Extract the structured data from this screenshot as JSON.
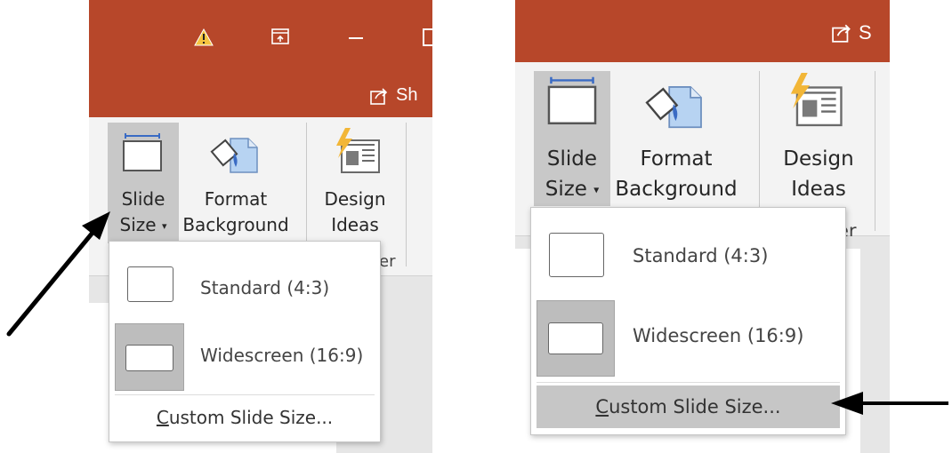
{
  "left_screenshot": {
    "titlebar": {
      "share_label": "Sh"
    },
    "ribbon": {
      "slide_size": {
        "line1": "Slide",
        "line2": "Size"
      },
      "format_background": {
        "line1": "Format",
        "line2": "Background"
      },
      "design_ideas": {
        "line1": "Design",
        "line2": "Ideas"
      },
      "group_label_fragment": "er"
    },
    "menu": {
      "standard_label": "Standard (4:3)",
      "widescreen_label": "Widescreen (16:9)",
      "custom_accel": "C",
      "custom_rest": "ustom Slide Size..."
    }
  },
  "right_screenshot": {
    "titlebar": {
      "share_label": "S"
    },
    "ribbon": {
      "slide_size": {
        "line1": "Slide",
        "line2": "Size"
      },
      "format_background": {
        "line1": "Format",
        "line2": "Background"
      },
      "design_ideas": {
        "line1": "Design",
        "line2": "Ideas"
      },
      "group_label_fragment": "er"
    },
    "menu": {
      "standard_label": "Standard (4:3)",
      "widescreen_label": "Widescreen (16:9)",
      "custom_accel": "C",
      "custom_rest": "ustom Slide Size..."
    }
  },
  "colors": {
    "titlebar": "#b7472a",
    "ribbon": "#f3f3f3",
    "selected": "#c8c8c8",
    "annotation_arrow": "#000000"
  },
  "icons": [
    "warning-icon",
    "ribbon-display-options-icon",
    "minimize-icon",
    "restore-icon",
    "share-icon",
    "slide-size-icon",
    "format-background-icon",
    "design-ideas-icon",
    "dropdown-caret-icon"
  ]
}
